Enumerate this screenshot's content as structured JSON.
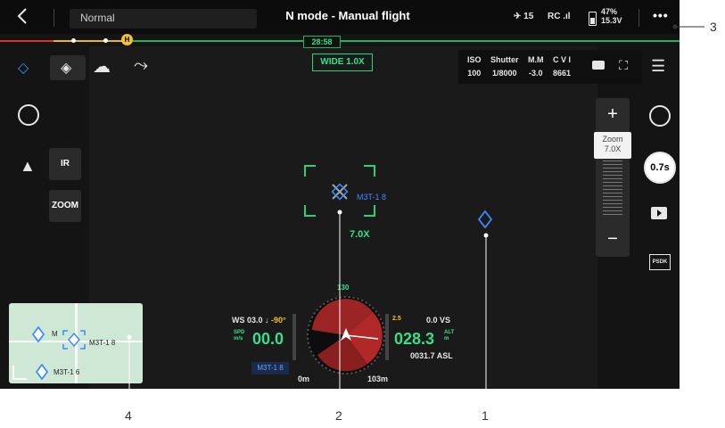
{
  "topbar": {
    "back_icon": "chevron-left-icon",
    "mode_select": "Normal",
    "flight_mode": "N mode - Manual flight",
    "satellite_count": "15",
    "rc_label": "RC",
    "battery_percent": "47%",
    "battery_voltage": "15.3V",
    "more_icon": "more-icon"
  },
  "timeline": {
    "time_remaining": "28:58",
    "home_marker": "H"
  },
  "camera_lens": {
    "label": "WIDE 1.0X"
  },
  "camera_params": {
    "iso_label": "ISO",
    "iso_value": "100",
    "shutter_label": "Shutter",
    "shutter_value": "1/8000",
    "ev_label": "M.M",
    "ev_value": "-3.0",
    "storage_label": "C V I",
    "storage_value": "8661"
  },
  "left_panel": {
    "ir_button": "IR",
    "zoom_button": "ZOOM"
  },
  "zoom": {
    "plus": "+",
    "minus": "−",
    "tip_label": "Zoom",
    "tip_value": "7.0X"
  },
  "right_panel": {
    "shutter_speed_button": "0.7s",
    "psdk_label": "PSDK"
  },
  "target": {
    "label": "M3T-1 8",
    "zoom_value": "7.0X"
  },
  "hud": {
    "ws_label": "WS 03.0",
    "ws_dir": "↓",
    "ws_angle": "-90°",
    "spd_label": "SPD",
    "spd_unit": "m/s",
    "spd_value": "00.0",
    "heading": "130",
    "alt_value": "028.3",
    "alt_label": "ALT",
    "alt_unit": "m",
    "vs_value": "0.0",
    "vs_label": "VS",
    "asl_value": "0031.7 ASL",
    "h_scale": "2.5",
    "device_badge": "M3T-1 8",
    "dist_home": "0m",
    "dist_target": "103m"
  },
  "minimap": {
    "label_top": "M",
    "label_drone": "M3T-1 8",
    "label_bottom": "M3T-1 6"
  },
  "callouts": {
    "c1": "1",
    "c2": "2",
    "c3": "3",
    "c4": "4"
  },
  "colors": {
    "accent_green": "#36e08a",
    "warning_red": "#d8322b",
    "marker_blue": "#3d8bff",
    "home_yellow": "#f2c12e"
  }
}
